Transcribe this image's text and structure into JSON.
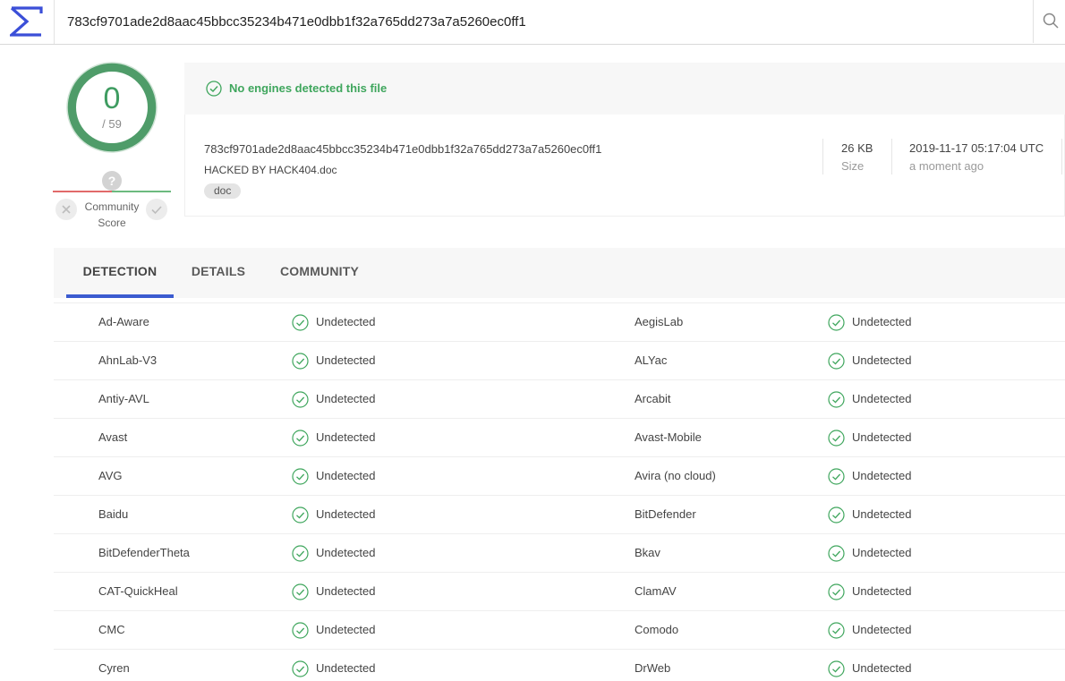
{
  "search": {
    "value": "783cf9701ade2d8aac45bbcc35234b471e0dbb1f32a765dd273a7a5260ec0ff1",
    "icon": "search-icon"
  },
  "score": {
    "detected": "0",
    "total": "/ 59",
    "community_label_1": "Community",
    "community_label_2": "Score",
    "unknown_mark": "?"
  },
  "summary": {
    "message": "No engines detected this file",
    "hash": "783cf9701ade2d8aac45bbcc35234b471e0dbb1f32a765dd273a7a5260ec0ff1",
    "filename": "HACKED BY HACK404.doc",
    "tag": "doc",
    "size_value": "26 KB",
    "size_label": "Size",
    "date_value": "2019-11-17 05:17:04 UTC",
    "date_label": "a moment ago"
  },
  "tabs": [
    {
      "label": "DETECTION",
      "active": true
    },
    {
      "label": "DETAILS",
      "active": false
    },
    {
      "label": "COMMUNITY",
      "active": false
    }
  ],
  "colors": {
    "accent_green": "#3fa65d",
    "tab_underline": "#3b5bd0",
    "logo_blue": "#3b4fd8"
  },
  "detections": [
    {
      "left_engine": "Ad-Aware",
      "left_result": "Undetected",
      "right_engine": "AegisLab",
      "right_result": "Undetected"
    },
    {
      "left_engine": "AhnLab-V3",
      "left_result": "Undetected",
      "right_engine": "ALYac",
      "right_result": "Undetected"
    },
    {
      "left_engine": "Antiy-AVL",
      "left_result": "Undetected",
      "right_engine": "Arcabit",
      "right_result": "Undetected"
    },
    {
      "left_engine": "Avast",
      "left_result": "Undetected",
      "right_engine": "Avast-Mobile",
      "right_result": "Undetected"
    },
    {
      "left_engine": "AVG",
      "left_result": "Undetected",
      "right_engine": "Avira (no cloud)",
      "right_result": "Undetected"
    },
    {
      "left_engine": "Baidu",
      "left_result": "Undetected",
      "right_engine": "BitDefender",
      "right_result": "Undetected"
    },
    {
      "left_engine": "BitDefenderTheta",
      "left_result": "Undetected",
      "right_engine": "Bkav",
      "right_result": "Undetected"
    },
    {
      "left_engine": "CAT-QuickHeal",
      "left_result": "Undetected",
      "right_engine": "ClamAV",
      "right_result": "Undetected"
    },
    {
      "left_engine": "CMC",
      "left_result": "Undetected",
      "right_engine": "Comodo",
      "right_result": "Undetected"
    },
    {
      "left_engine": "Cyren",
      "left_result": "Undetected",
      "right_engine": "DrWeb",
      "right_result": "Undetected"
    }
  ]
}
